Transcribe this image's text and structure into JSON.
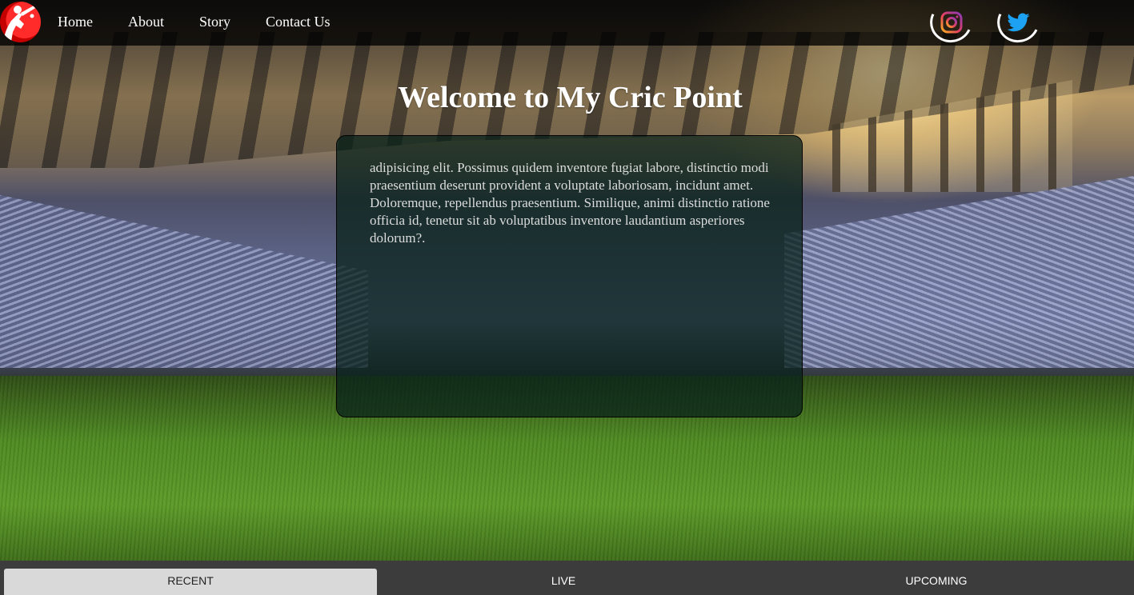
{
  "nav": {
    "logo_icon": "cricket-batsman-logo",
    "links": [
      {
        "label": "Home"
      },
      {
        "label": "About"
      },
      {
        "label": "Story"
      },
      {
        "label": "Contact Us"
      }
    ],
    "social": [
      {
        "icon": "instagram-icon"
      },
      {
        "icon": "twitter-icon"
      }
    ]
  },
  "hero": {
    "title": "Welcome to My Cric Point",
    "body": "adipisicing elit. Possimus quidem inventore fugiat labore, distinctio modi praesentium deserunt provident a voluptate laboriosam, incidunt amet. Doloremque, repellendus praesentium. Similique, animi distinctio ratione officia id, tenetur sit ab voluptatibus inventore laudantium asperiores dolorum?."
  },
  "tabs": [
    {
      "label": "RECENT",
      "active": true
    },
    {
      "label": "LIVE",
      "active": false
    },
    {
      "label": "UPCOMING",
      "active": false
    }
  ],
  "colors": {
    "navbar": "#000000",
    "logo": "#e60000",
    "instagram": "#d6249f",
    "twitter": "#1da1f2",
    "active_tab": "#d9d9d9",
    "tabbar": "#3c3c3c"
  }
}
